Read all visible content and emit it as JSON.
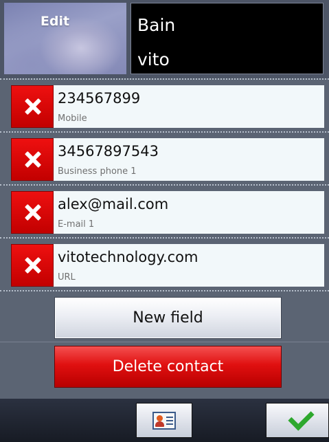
{
  "header": {
    "photo_label": "Edit",
    "first_name": "Bain",
    "last_name": "vito"
  },
  "fields": [
    {
      "value": "234567899",
      "label": "Mobile"
    },
    {
      "value": "34567897543",
      "label": "Business phone 1"
    },
    {
      "value": "alex@mail.com",
      "label": "E-mail 1"
    },
    {
      "value": "vitotechnology.com",
      "label": "URL"
    }
  ],
  "actions": {
    "new_field": "New field",
    "delete_contact": "Delete contact"
  },
  "toolbar": {
    "contact_icon": "contact-card-icon",
    "ok_icon": "checkmark-icon"
  },
  "colors": {
    "delete_red": "#e01010",
    "background": "#5b6473",
    "checkmark": "#2ea82e"
  }
}
